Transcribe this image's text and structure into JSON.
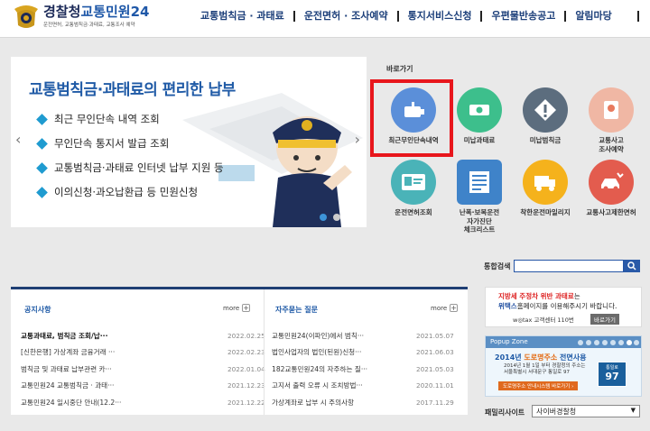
{
  "header": {
    "logo_main_a": "경찰청",
    "logo_main_b": "교통민원24",
    "logo_sub": "운전면허, 교통범칙금·과태료, 교통조사 예약",
    "nav": [
      "교통범칙금 · 과태료",
      "운전면허 · 조사예약",
      "통지서비스신청",
      "우편물반송공고",
      "알림마당"
    ]
  },
  "banner": {
    "title": "교통범칙금·과태료의 편리한 납부",
    "items": [
      "최근 무인단속 내역 조회",
      "무인단속 통지서 발급 조회",
      "교통범칙금·과태료 인터넷 납부 지원 등",
      "이의신청·과오납환급 등 민원신청"
    ],
    "prev": "‹",
    "next": "›"
  },
  "quick": {
    "title": "바로가기",
    "items": [
      {
        "label": "최근무인단속내역",
        "icon": "camera-icon",
        "color": "#5b8fd9"
      },
      {
        "label": "미납과태료",
        "icon": "banknote-icon",
        "color": "#3dbf8c"
      },
      {
        "label": "미납범칙금",
        "icon": "warning-icon",
        "color": "#5c6d7e"
      },
      {
        "label": "교통사고\n조사예약",
        "icon": "report-icon",
        "color": "#f0b7a4"
      },
      {
        "label": "운전면허조회",
        "icon": "id-card-icon",
        "color": "#4ab3b8"
      },
      {
        "label": "난폭·보복운전\n자가진단\n체크리스트",
        "icon": "checklist-icon",
        "color": "#3f83c9"
      },
      {
        "label": "착한운전마일리지",
        "icon": "mileage-truck-icon",
        "color": "#f5b21c"
      },
      {
        "label": "교통사고제한면허",
        "icon": "crash-car-icon",
        "color": "#e35c4e"
      }
    ]
  },
  "search": {
    "label": "통합검색",
    "value": ""
  },
  "notice": {
    "head": "공지사항",
    "more": "more",
    "rows": [
      {
        "title": "교통과태료, 범칙금 조회/납···",
        "date": "2022.02.25"
      },
      {
        "title": "[신한은행] 가상계좌 금융거래 ···",
        "date": "2022.02.23"
      },
      {
        "title": "범칙금 및 과태료 납부관련 카···",
        "date": "2022.01.04"
      },
      {
        "title": "교통민원24 교통범칙금 · 과태···",
        "date": "2021.12.23"
      },
      {
        "title": "교통민원24 일시중단 안내(12.2···",
        "date": "2021.12.22"
      }
    ]
  },
  "faq": {
    "head": "자주묻는 질문",
    "more": "more",
    "rows": [
      {
        "title": "교통민원24(이파인)에서 범칙···",
        "date": "2021.05.07"
      },
      {
        "title": "법인사업자의 법인(된원)신청···",
        "date": "2021.06.03"
      },
      {
        "title": "182교통민원24의 자주하는 질···",
        "date": "2021.05.03"
      },
      {
        "title": "고지서 출력 오류 시 조치방법···",
        "date": "2020.11.01"
      },
      {
        "title": "가상계좌로 납부 시 주의사항",
        "date": "2017.11.29"
      }
    ]
  },
  "ad": {
    "l1_red": "지방세 주정차 위반 과태료",
    "l1_rest": "는",
    "l2_bold": "위택스",
    "l2_rest": "홈페이지를 이용해주시기 바랍니다.",
    "l3": "w◎tax 고객센터 110번",
    "btn": "바로가기"
  },
  "popup": {
    "title": "Popup Zone",
    "headline_a": "2014년 ",
    "headline_b": "도로명주소",
    "headline_c": " 전면사용",
    "line1": "2014년 1월 1일 부터 경찰청의 주소는",
    "line2": "서울특별시 서대문구 통일로 97",
    "btn": "도로명주소 안내시스템 바로가기 ›",
    "sign_top": "통일로",
    "sign_num": "97"
  },
  "family": {
    "label": "패밀리사이트",
    "selected": "사이버경찰청"
  }
}
